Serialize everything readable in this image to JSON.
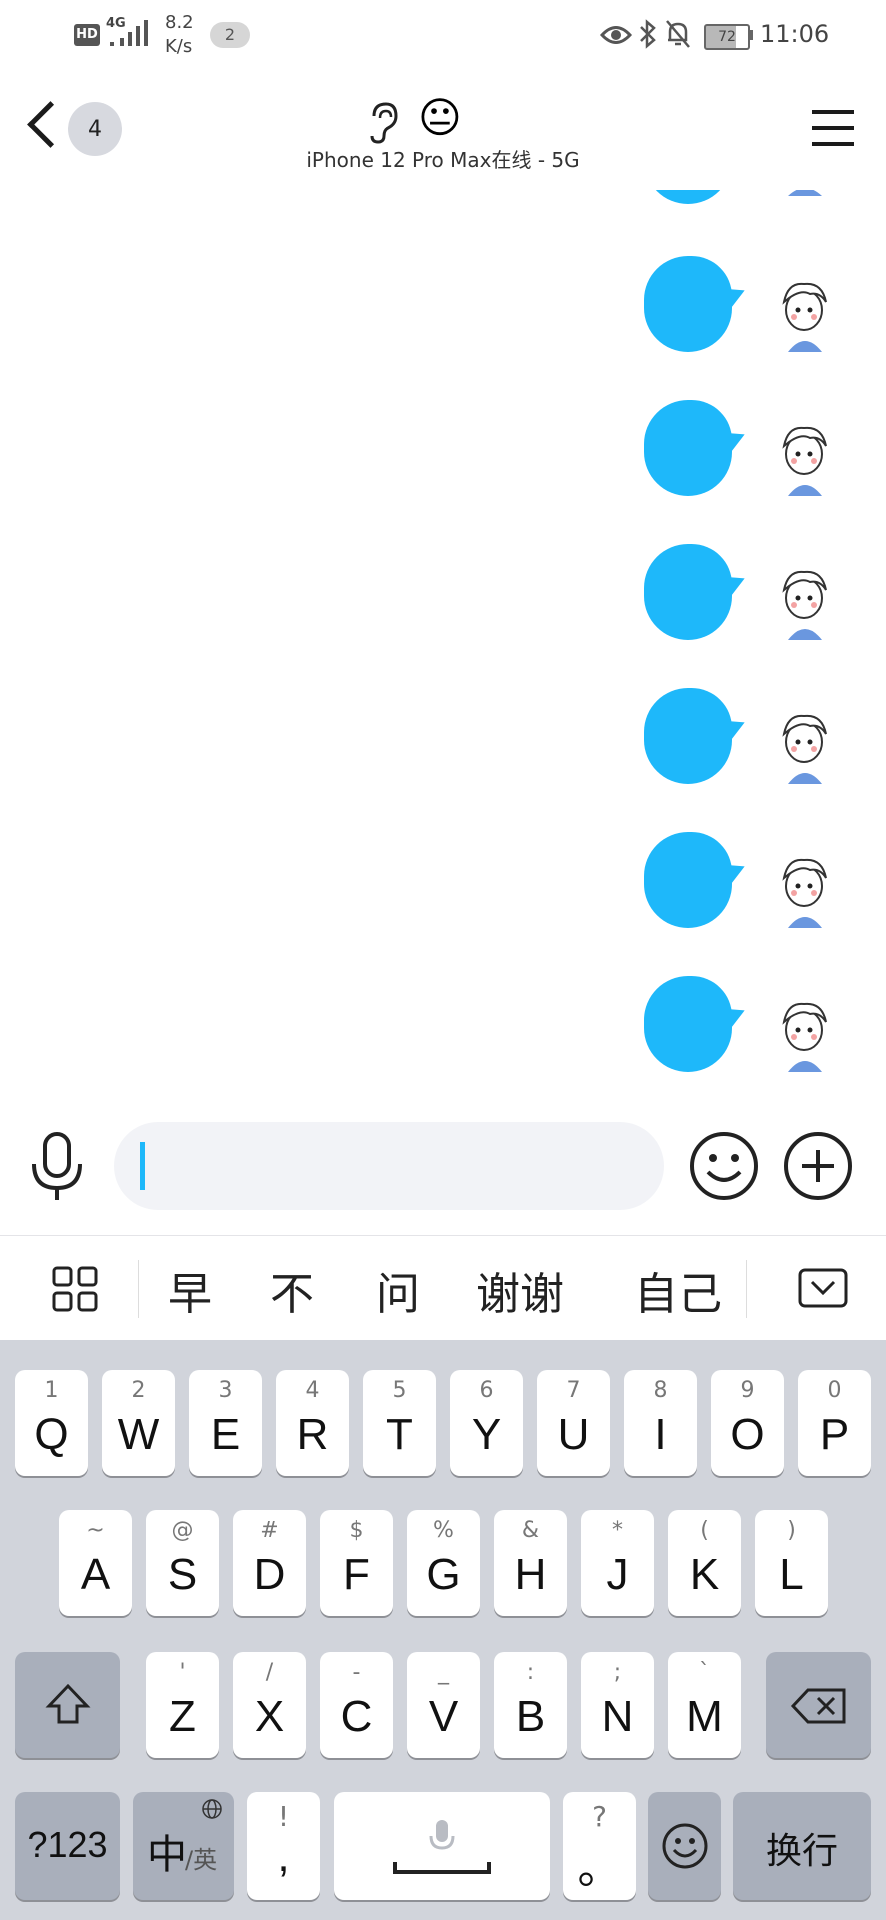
{
  "status_bar": {
    "hd": "HD",
    "network": "4G",
    "speed_value": "8.2",
    "speed_unit": "K/s",
    "notification_count": "2",
    "battery": "72",
    "time": "11:06"
  },
  "header": {
    "unread_count": "4",
    "contact_emoji": "😐",
    "subtitle": "iPhone 12 Pro Max在线 - 5G"
  },
  "input": {
    "placeholder": ""
  },
  "suggestions": [
    "早",
    "不",
    "问",
    "谢谢",
    "自己"
  ],
  "keyboard": {
    "row1": [
      {
        "sub": "1",
        "main": "Q"
      },
      {
        "sub": "2",
        "main": "W"
      },
      {
        "sub": "3",
        "main": "E"
      },
      {
        "sub": "4",
        "main": "R"
      },
      {
        "sub": "5",
        "main": "T"
      },
      {
        "sub": "6",
        "main": "Y"
      },
      {
        "sub": "7",
        "main": "U"
      },
      {
        "sub": "8",
        "main": "I"
      },
      {
        "sub": "9",
        "main": "O"
      },
      {
        "sub": "0",
        "main": "P"
      }
    ],
    "row2": [
      {
        "sub": "~",
        "main": "A"
      },
      {
        "sub": "@",
        "main": "S"
      },
      {
        "sub": "#",
        "main": "D"
      },
      {
        "sub": "$",
        "main": "F"
      },
      {
        "sub": "%",
        "main": "G"
      },
      {
        "sub": "&",
        "main": "H"
      },
      {
        "sub": "*",
        "main": "J"
      },
      {
        "sub": "(",
        "main": "K"
      },
      {
        "sub": ")",
        "main": "L"
      }
    ],
    "row3": [
      {
        "sub": "'",
        "main": "Z"
      },
      {
        "sub": "/",
        "main": "X"
      },
      {
        "sub": "-",
        "main": "C"
      },
      {
        "sub": "_",
        "main": "V"
      },
      {
        "sub": ":",
        "main": "B"
      },
      {
        "sub": ";",
        "main": "N"
      },
      {
        "sub": "`",
        "main": "M"
      }
    ],
    "num_key": "?123",
    "lang_key_main": "中",
    "lang_key_sub": "/英",
    "comma_sub": "!",
    "comma_main": ",",
    "period_sub": "?",
    "period_main": "。",
    "enter_key": "换行"
  },
  "colors": {
    "bubble": "#1eb8fa",
    "keyboard_bg": "#d1d4db",
    "dark_key": "#a9afbb"
  }
}
